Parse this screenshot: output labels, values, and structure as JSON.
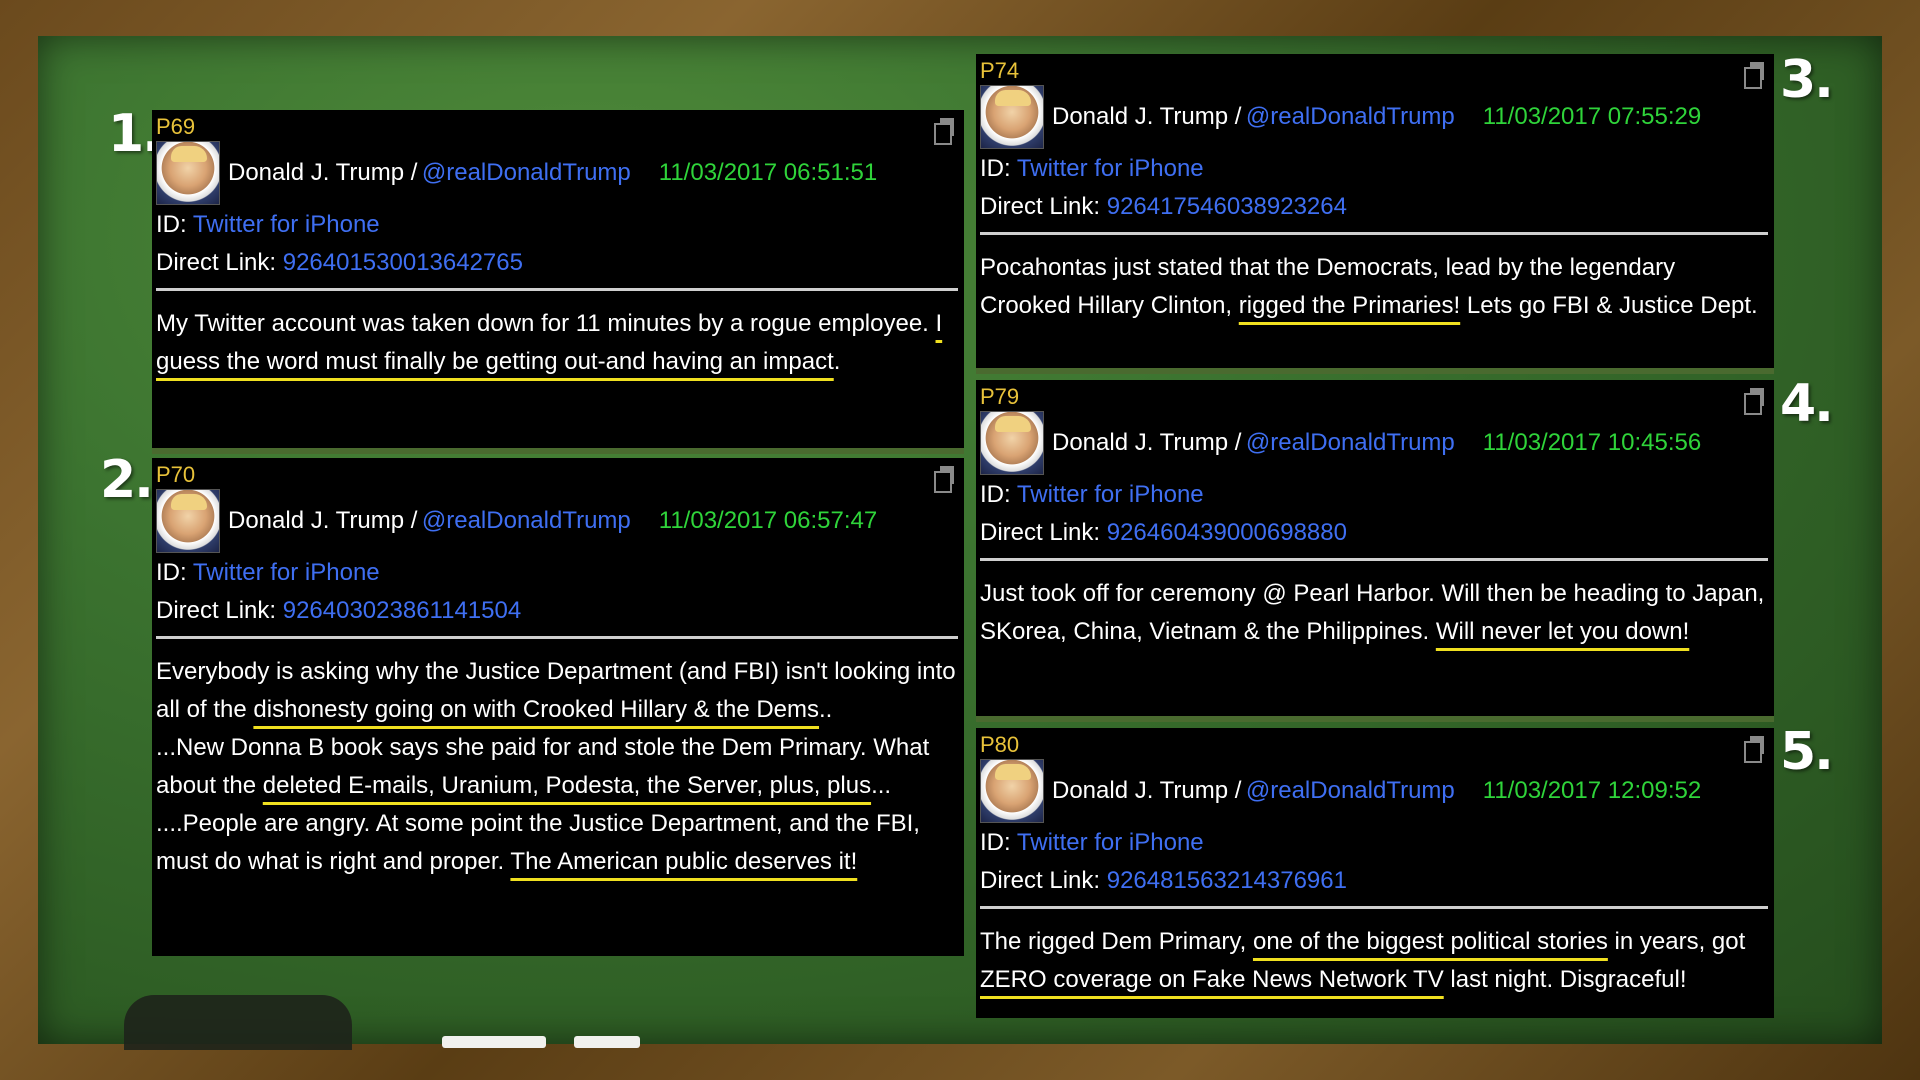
{
  "numbers": [
    "1.",
    "2.",
    "3.",
    "4.",
    "5."
  ],
  "cards": [
    {
      "id": "P69",
      "author": "Donald J. Trump /",
      "handle": "@realDonaldTrump",
      "timestamp": "11/03/2017 06:51:51",
      "id_label": "ID:",
      "source": "Twitter for iPhone",
      "link_label": "Direct Link:",
      "link": "926401530013642765",
      "text_plain_1": "My Twitter account was taken down for 11 minutes by a rogue employee. ",
      "text_hl_1": "I guess the word must finally be getting out-and having an impact",
      "text_plain_2": "."
    },
    {
      "id": "P70",
      "author": "Donald J. Trump /",
      "handle": "@realDonaldTrump",
      "timestamp": "11/03/2017 06:57:47",
      "id_label": "ID:",
      "source": "Twitter for iPhone",
      "link_label": "Direct Link:",
      "link": "926403023861141504",
      "p1_plain": "Everybody is asking why the Justice Department (and FBI) isn't looking into all of the ",
      "p1_hl": "dishonesty going on with Crooked Hillary & the Dems",
      "p1_end": "..",
      "p2_plain": "...New Donna B book says she paid for and stole the Dem Primary. What about the ",
      "p2_hl": "deleted E-mails, Uranium, Podesta, the Server, plus, plus",
      "p2_end": "...",
      "p3_plain": "....People are angry.  At some point the Justice Department, and the FBI, must do what is right and proper. ",
      "p3_hl": "The American public deserves it!"
    },
    {
      "id": "P74",
      "author": "Donald J. Trump /",
      "handle": "@realDonaldTrump",
      "timestamp": "11/03/2017 07:55:29",
      "id_label": "ID:",
      "source": "Twitter for iPhone",
      "link_label": "Direct Link:",
      "link": "926417546038923264",
      "text_plain_1": "Pocahontas just stated that the Democrats, lead by the legendary Crooked Hillary Clinton, ",
      "text_hl_1": "rigged the Primaries!",
      "text_plain_2": " Lets go FBI & Justice Dept."
    },
    {
      "id": "P79",
      "author": "Donald J. Trump /",
      "handle": "@realDonaldTrump",
      "timestamp": "11/03/2017 10:45:56",
      "id_label": "ID:",
      "source": "Twitter for iPhone",
      "link_label": "Direct Link:",
      "link": "926460439000698880",
      "text_plain_1": "Just took off for ceremony @ Pearl Harbor. Will then be heading to Japan, SKorea, China, Vietnam & the Philippines. ",
      "text_hl_1": "Will never let you down!",
      "text_plain_2": ""
    },
    {
      "id": "P80",
      "author": "Donald J. Trump /",
      "handle": "@realDonaldTrump",
      "timestamp": "11/03/2017 12:09:52",
      "id_label": "ID:",
      "source": "Twitter for iPhone",
      "link_label": "Direct Link:",
      "link": "926481563214376961",
      "text_plain_1": "The rigged Dem Primary, ",
      "text_hl_1": "one of the biggest political stories",
      "text_plain_2": " in years, got ",
      "text_hl_2": "ZERO coverage on Fake News Network TV",
      "text_plain_3": " last night. Disgraceful!"
    }
  ]
}
